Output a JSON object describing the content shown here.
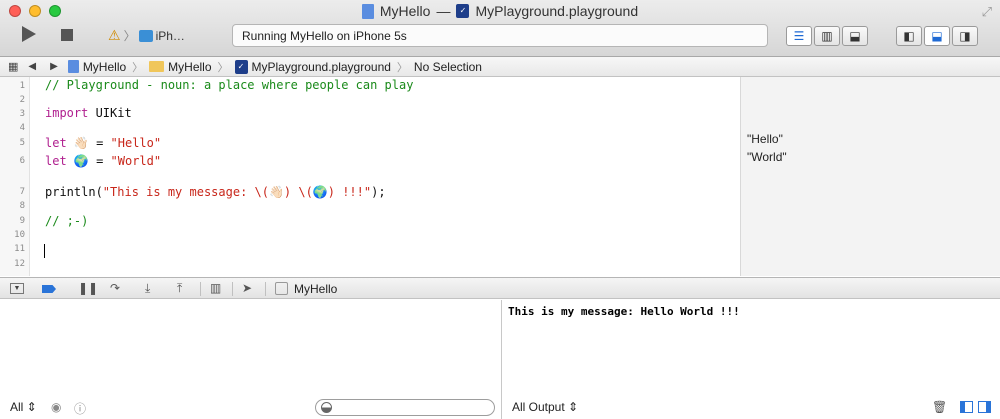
{
  "window": {
    "title_project": "MyHello",
    "title_separator": "—",
    "title_file": "MyPlayground.playground"
  },
  "toolbar": {
    "scheme_device": "iPh…",
    "activity_status": "Running MyHello on iPhone 5s"
  },
  "jumpbar": {
    "crumbs": [
      "MyHello",
      "MyHello",
      "MyPlayground.playground",
      "No Selection"
    ]
  },
  "editor": {
    "line_numbers": [
      "1",
      "2",
      "3",
      "4",
      "5",
      "6",
      "7",
      "8",
      "9",
      "10",
      "11",
      "12"
    ],
    "line1_comment": "// Playground - noun: a place where people can play",
    "line3_kw": "import",
    "line3_rest": " UIKit",
    "line5_kw": "let",
    "line5_var": " 👋🏻 = ",
    "line5_str": "\"Hello\"",
    "line6_kw": "let",
    "line6_var": " 🌍 = ",
    "line6_str": "\"World\"",
    "line8_fn": "println(",
    "line8_str": "\"This is my message: \\(👋🏻) \\(🌍) !!!\"",
    "line8_end": ");",
    "line10_comment": "// ;-)"
  },
  "results": {
    "line5": "\"Hello\"",
    "line6": "\"World\""
  },
  "debug": {
    "target_label": "MyHello"
  },
  "variables": {
    "scope_select": "All ⇕"
  },
  "console": {
    "output": "This is my message: Hello World !!!",
    "output_select": "All Output ⇕"
  },
  "colors": {
    "comment": "#1a8a1a",
    "keyword": "#b0208f",
    "string": "#c8261a",
    "accent": "#2a74d8"
  }
}
